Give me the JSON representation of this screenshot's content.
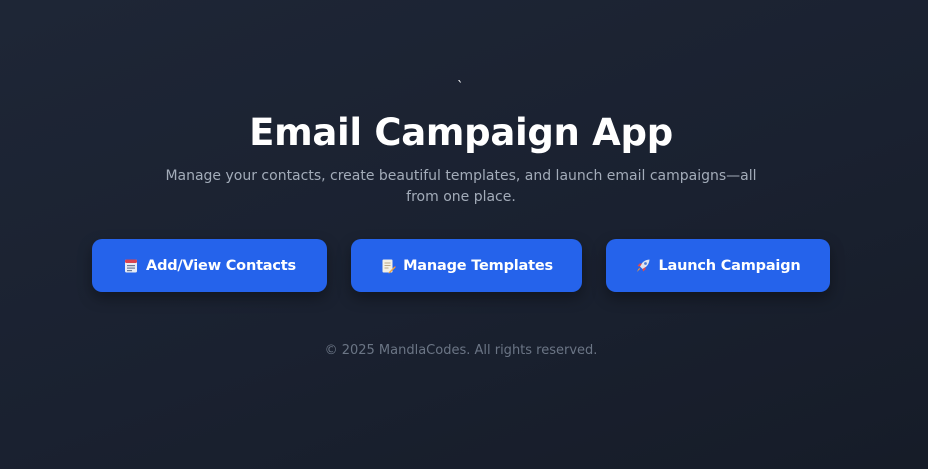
{
  "page": {
    "stray_mark": "`",
    "title": "Email Campaign App",
    "subtitle": "Manage your contacts, create beautiful templates, and launch email campaigns—all from one place.",
    "footer": "© 2025 MandlaCodes. All rights reserved."
  },
  "actions": [
    {
      "label": "Add/View Contacts",
      "icon": "card-index-icon"
    },
    {
      "label": "Manage Templates",
      "icon": "memo-icon"
    },
    {
      "label": "Launch Campaign",
      "icon": "rocket-icon"
    }
  ],
  "colors": {
    "background": "#1c2331",
    "button": "#2563eb",
    "subtitle": "#a3acb9",
    "footer": "#6b7585"
  }
}
